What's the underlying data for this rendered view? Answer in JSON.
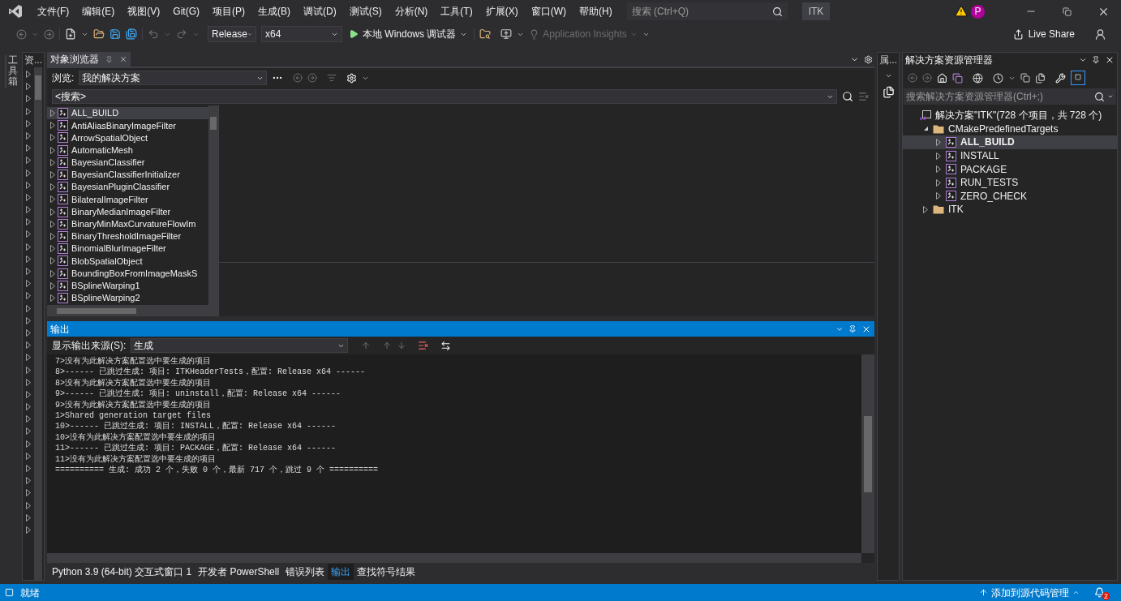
{
  "menu_bar": {
    "items": [
      "文件(F)",
      "编辑(E)",
      "视图(V)",
      "Git(G)",
      "项目(P)",
      "生成(B)",
      "调试(D)",
      "测试(S)",
      "分析(N)",
      "工具(T)",
      "扩展(X)",
      "窗口(W)",
      "帮助(H)"
    ],
    "search": {
      "placeholder": "搜索 (Ctrl+Q)"
    },
    "solution_name": "ITK",
    "avatar": "P"
  },
  "toolbar": {
    "configuration": "Release",
    "platform": "x64",
    "run_target": "本地 Windows 调试器",
    "insights": "Application Insights",
    "live_share": "Live Share"
  },
  "toolbox_tab": "工具箱",
  "side_tab": "资...",
  "object_browser": {
    "tab": "对象浏览器",
    "browse_label": "浏览:",
    "browse_value": "我的解决方案",
    "search_placeholder": "<搜索>",
    "items": [
      {
        "label": "ALL_BUILD",
        "selected": true
      },
      {
        "label": "AntiAliasBinaryImageFilter",
        "selected": false
      },
      {
        "label": "ArrowSpatialObject",
        "selected": false
      },
      {
        "label": "AutomaticMesh",
        "selected": false
      },
      {
        "label": "BayesianClassifier",
        "selected": false
      },
      {
        "label": "BayesianClassifierInitializer",
        "selected": false
      },
      {
        "label": "BayesianPluginClassifier",
        "selected": false
      },
      {
        "label": "BilateralImageFilter",
        "selected": false
      },
      {
        "label": "BinaryMedianImageFilter",
        "selected": false
      },
      {
        "label": "BinaryMinMaxCurvatureFlowIm",
        "selected": false
      },
      {
        "label": "BinaryThresholdImageFilter",
        "selected": false
      },
      {
        "label": "BinomialBlurImageFilter",
        "selected": false
      },
      {
        "label": "BlobSpatialObject",
        "selected": false
      },
      {
        "label": "BoundingBoxFromImageMaskS",
        "selected": false
      },
      {
        "label": "BSplineWarping1",
        "selected": false
      },
      {
        "label": "BSplineWarping2",
        "selected": false
      }
    ]
  },
  "output": {
    "title": "输出",
    "source_label": "显示输出来源(S):",
    "source_value": "生成",
    "lines": [
      "7>没有为此解决方案配置选中要生成的项目",
      "8>------ 已跳过生成: 项目: ITKHeaderTests，配置: Release x64 ------",
      "8>没有为此解决方案配置选中要生成的项目",
      "9>------ 已跳过生成: 项目: uninstall，配置: Release x64 ------",
      "9>没有为此解决方案配置选中要生成的项目",
      "1>Shared generation target files",
      "10>------ 已跳过生成: 项目: INSTALL，配置: Release x64 ------",
      "10>没有为此解决方案配置选中要生成的项目",
      "11>------ 已跳过生成: 项目: PACKAGE，配置: Release x64 ------",
      "11>没有为此解决方案配置选中要生成的项目",
      "========== 生成: 成功 2 个，失败 0 个，最新 717 个，跳过 9 个 =========="
    ]
  },
  "bottom_tabs": [
    {
      "label": "Python 3.9 (64-bit) 交互式窗口 1",
      "selected": false
    },
    {
      "label": "开发者 PowerShell",
      "selected": false
    },
    {
      "label": "错误列表",
      "selected": false
    },
    {
      "label": "输出",
      "selected": true
    },
    {
      "label": "查找符号结果",
      "selected": false
    }
  ],
  "properties_tab": "属...",
  "solution_explorer": {
    "title": "解决方案资源管理器",
    "search_placeholder": "搜索解决方案资源管理器(Ctrl+;)",
    "tree": [
      {
        "label": "解决方案\"ITK\"(728 个项目，共 728 个)",
        "kind": "solution",
        "selected": false,
        "children": [
          {
            "label": "CMakePredefinedTargets",
            "kind": "folder",
            "expanded": true,
            "selected": false,
            "children": [
              {
                "label": "ALL_BUILD",
                "kind": "project",
                "expanded": false,
                "selected": true
              },
              {
                "label": "INSTALL",
                "kind": "project",
                "expanded": false,
                "selected": false
              },
              {
                "label": "PACKAGE",
                "kind": "project",
                "expanded": false,
                "selected": false
              },
              {
                "label": "RUN_TESTS",
                "kind": "project",
                "expanded": false,
                "selected": false
              },
              {
                "label": "ZERO_CHECK",
                "kind": "project",
                "expanded": false,
                "selected": false
              }
            ]
          },
          {
            "label": "ITK",
            "kind": "folder",
            "expanded": false,
            "selected": false
          }
        ]
      }
    ]
  },
  "status_bar": {
    "text": "就绪",
    "source_control": "添加到源代码管理",
    "notifications": "2"
  }
}
